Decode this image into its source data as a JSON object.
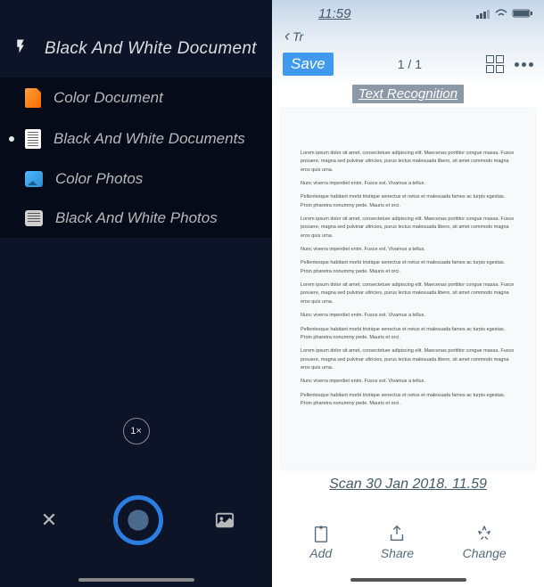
{
  "left": {
    "mode_title": "Black And White Document Car",
    "menu": [
      {
        "label": "Color Document",
        "icon": "doc-color"
      },
      {
        "label": "Black And White Documents",
        "icon": "doc-bw",
        "selected": true
      },
      {
        "label": "Color Photos",
        "icon": "photo-color"
      },
      {
        "label": "Black And White Photos",
        "icon": "photo-bw"
      }
    ],
    "zoom": "1×",
    "close": "✕"
  },
  "right": {
    "status_time": "11:59",
    "back_label": "Tr",
    "save_label": "Save",
    "page_counter": "1 / 1",
    "text_recognition": "Text Recognition",
    "filename": "Scan 30 Jan 2018. 11.59",
    "bottom": {
      "add": "Add",
      "share": "Share",
      "change": "Change"
    },
    "doc_paragraphs": [
      "Lorem ipsum dolor sit amet, consectetuer adipiscing elit. Maecenas porttitor congue massa. Fusce posuere, magna sed pulvinar ultricies, purus lectus malesuada libero, sit amet commodo magna eros quis urna.",
      "Nunc viverra imperdiet enim. Fusce est. Vivamus a tellus.",
      "Pellentesque habitant morbi tristique senectus et netus et malesuada fames ac turpis egestas. Proin pharetra nonummy pede. Mauris et orci.",
      "Lorem ipsum dolor sit amet, consectetuer adipiscing elit. Maecenas porttitor congue massa. Fusce posuere, magna sed pulvinar ultricies, purus lectus malesuada libero, sit amet commodo magna eros quis urna.",
      "Nunc viverra imperdiet enim. Fusce est. Vivamus a tellus.",
      "Pellentesque habitant morbi tristique senectus et netus et malesuada fames ac turpis egestas. Proin pharetra nonummy pede. Mauris et orci.",
      "Lorem ipsum dolor sit amet, consectetuer adipiscing elit. Maecenas porttitor congue massa. Fusce posuere, magna sed pulvinar ultricies, purus lectus malesuada libero, sit amet commodo magna eros quis urna.",
      "Nunc viverra imperdiet enim. Fusce est. Vivamus a tellus.",
      "Pellentesque habitant morbi tristique senectus et netus et malesuada fames ac turpis egestas. Proin pharetra nonummy pede. Mauris et orci.",
      "Lorem ipsum dolor sit amet, consectetuer adipiscing elit. Maecenas porttitor congue massa. Fusce posuere, magna sed pulvinar ultricies, purus lectus malesuada libero, sit amet commodo magna eros quis urna.",
      "Nunc viverra imperdiet enim. Fusce est. Vivamus a tellus.",
      "Pellentesque habitant morbi tristique senectus et netus et malesuada fames ac turpis egestas. Proin pharetra nonummy pede. Mauris et orci."
    ]
  }
}
